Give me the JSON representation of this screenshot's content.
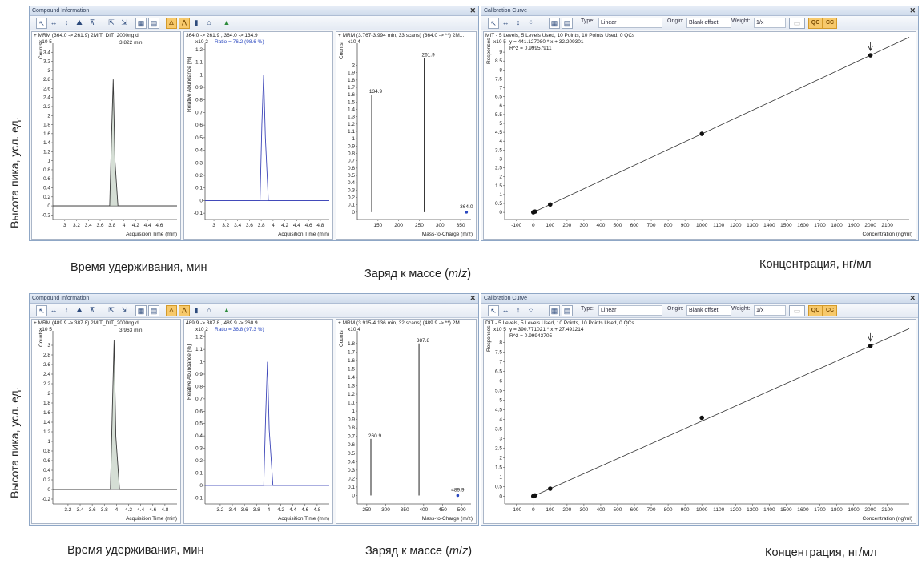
{
  "y_axis_caption": "Высота пика, усл. ед.",
  "rows": [
    {
      "compound_window_title": "Compound Information",
      "calibration_window_title": "Calibration Curve",
      "chrom": {
        "header": "+ MRM (364.0 -> 261.9) 2MIT_DIT_2000ng.d",
        "scale": "x10 5",
        "yunit": "Counts",
        "peak_label": "3.822 min.",
        "xaxis_title": "Acquisition Time (min)"
      },
      "qual": {
        "header": "364.0 -> 261.9 , 364.0 -> 134.9",
        "scale": "x10 2",
        "ratio": "Ratio = 76.2 (98.6 %)",
        "yunit": "Relative Abundance [%]",
        "xaxis_title": "Acquisition Time (min)"
      },
      "ms": {
        "header": "+ MRM (3.767-3.994 min, 33 scans) (364.0 -> **) 2M...",
        "scale": "x10 4",
        "yunit": "Counts",
        "peak_labels": [
          "134.9",
          "261.9",
          "364.0"
        ],
        "xaxis_title": "Mass-to-Charge (m/z)"
      },
      "cal": {
        "header": "MIT - 5 Levels, 5 Levels Used, 10 Points, 10 Points Used, 0 QCs",
        "scale": "x10 5",
        "equation": "y = 441.127080 * x + 32.209301",
        "r2": "R^2 = 0.99957911",
        "yunit": "Responses",
        "xaxis_title": "Concentration (ng/ml)"
      },
      "captions": {
        "time": "Время удерживания, мин",
        "mass_prefix": "Заряд к массе (",
        "mass_m": "m",
        "mass_sep": "/",
        "mass_z": "z",
        "mass_suffix": ")",
        "conc": "Концентрация, нг/мл"
      }
    },
    {
      "compound_window_title": "Compound Information",
      "calibration_window_title": "Calibration Curve",
      "chrom": {
        "header": "+ MRM (489.9 -> 387.8) 2MIT_DIT_2000ng.d",
        "scale": "x10 5",
        "yunit": "Counts",
        "peak_label": "3.963 min.",
        "xaxis_title": "Acquisition Time (min)"
      },
      "qual": {
        "header": "489.9 -> 387.8 , 489.9 -> 260.9",
        "scale": "x10 2",
        "ratio": "Ratio = 36.8 (97.3 %)",
        "yunit": "Relative Abundance [%]",
        "xaxis_title": "Acquisition Time (min)"
      },
      "ms": {
        "header": "+ MRM (3.915-4.136 min, 32 scans) (489.9 -> **) 2M...",
        "scale": "x10 4",
        "yunit": "Counts",
        "peak_labels": [
          "260.9",
          "387.8",
          "489.9"
        ],
        "xaxis_title": "Mass-to-Charge (m/z)"
      },
      "cal": {
        "header": "DIT - 5 Levels, 5 Levels Used, 10 Points, 10 Points Used, 0 QCs",
        "scale": "x10 5",
        "equation": "y = 390.771021 * x + 27.491214",
        "r2": "R^2 = 0.99943705",
        "yunit": "Responses",
        "xaxis_title": "Concentration (ng/ml)"
      },
      "captions": {
        "time": "Время удерживания, мин",
        "mass_prefix": "Заряд к массе (",
        "mass_m": "m",
        "mass_sep": "/",
        "mass_z": "z",
        "mass_suffix": ")",
        "conc": "Концентрация, нг/мл"
      }
    }
  ],
  "toolbar": {
    "type_label": "Type:",
    "type_value": "Linear",
    "origin_label": "Origin:",
    "origin_value": "Blank offset",
    "weight_label": "Weight:",
    "weight_value": "1/x",
    "qc_label": "QC",
    "cc_label": "CC",
    "icons": [
      "cursor-icon",
      "pan-horizontal-icon",
      "pan-vertical-icon",
      "peak-icon",
      "baseline-icon",
      "zoom-icon",
      "overlay-icon",
      "table-icon",
      "export-icon",
      "integrate-icon",
      "qualifier-icon",
      "bar-chart-icon",
      "spectrum-icon",
      "arrow-up-icon"
    ]
  },
  "chart_data": [
    {
      "type": "line",
      "title": "+ MRM (364.0 -> 261.9) 2MIT_DIT_2000ng.d",
      "xlabel": "Acquisition Time (min)",
      "ylabel": "Counts",
      "ylim": [
        -0.3,
        3.6
      ],
      "xlim": [
        2.8,
        4.9
      ],
      "yticks": [
        "-0.2",
        "0",
        "0.2",
        "0.4",
        "0.6",
        "0.8",
        "1",
        "1.2",
        "1.4",
        "1.6",
        "1.8",
        "2",
        "2.2",
        "2.4",
        "2.6",
        "2.8",
        "3",
        "3.2",
        "3.4"
      ],
      "xticks": [
        "3",
        "3.2",
        "3.4",
        "3.6",
        "3.8",
        "4",
        "4.2",
        "4.4",
        "4.6"
      ],
      "series": [
        {
          "name": "364.0 -> 261.9",
          "x": [
            2.8,
            3.76,
            3.79,
            3.82,
            3.85,
            3.9,
            4.9
          ],
          "y": [
            0,
            0,
            1.5,
            2.8,
            1.0,
            0,
            0
          ]
        }
      ]
    },
    {
      "type": "line",
      "title": "364.0 -> 261.9 , 364.0 -> 134.9",
      "xlabel": "Acquisition Time (min)",
      "ylabel": "Relative Abundance [%]",
      "ylim": [
        -0.15,
        1.25
      ],
      "xlim": [
        2.85,
        4.95
      ],
      "yticks": [
        "-0.1",
        "0",
        "0.1",
        "0.2",
        "0.3",
        "0.4",
        "0.5",
        "0.6",
        "0.7",
        "0.8",
        "0.9",
        "1",
        "1.1",
        "1.2"
      ],
      "xticks": [
        "3",
        "3.2",
        "3.4",
        "3.6",
        "3.8",
        "4",
        "4.2",
        "4.4",
        "4.6",
        "4.8"
      ],
      "series": [
        {
          "name": "364.0 -> 134.9",
          "x": [
            2.85,
            3.78,
            3.81,
            3.84,
            3.87,
            3.92,
            4.95
          ],
          "y": [
            0,
            0,
            0.6,
            1.0,
            0.5,
            0,
            0
          ]
        }
      ]
    },
    {
      "type": "bar",
      "title": "+ MRM (3.767-3.994 min, 33 scans) (364.0 -> **) 2M...",
      "xlabel": "Mass-to-Charge (m/z)",
      "ylabel": "Counts",
      "ylim": [
        -0.1,
        2.3
      ],
      "xlim": [
        100,
        375
      ],
      "yticks": [
        "0",
        "0.1",
        "0.2",
        "0.3",
        "0.4",
        "0.5",
        "0.6",
        "0.7",
        "0.8",
        "0.9",
        "1",
        "1.1",
        "1.2",
        "1.3",
        "1.4",
        "1.5",
        "1.6",
        "1.7",
        "1.8",
        "1.9",
        "2"
      ],
      "xticks": [
        "150",
        "200",
        "250",
        "300",
        "350"
      ],
      "x": [
        134.9,
        261.9,
        364.0
      ],
      "values": [
        1.6,
        2.1,
        0.0
      ]
    },
    {
      "type": "scatter",
      "title": "MIT - 5 Levels, 5 Levels Used, 10 Points, 10 Points Used, 0 QCs",
      "xlabel": "Concentration (ng/ml)",
      "ylabel": "Responses",
      "ylim": [
        -0.4,
        9.5
      ],
      "xlim": [
        -170,
        2230
      ],
      "yticks": [
        "-0.5",
        "0",
        "0.5",
        "1",
        "1.5",
        "2",
        "2.5",
        "3",
        "3.5",
        "4",
        "4.5",
        "5",
        "5.5",
        "6",
        "6.5",
        "7",
        "7.5",
        "8",
        "8.5",
        "9"
      ],
      "xticks": [
        "-100",
        "0",
        "100",
        "200",
        "300",
        "400",
        "500",
        "600",
        "700",
        "800",
        "900",
        "1000",
        "1100",
        "1200",
        "1300",
        "1400",
        "1500",
        "1600",
        "1700",
        "1800",
        "1900",
        "2000",
        "2100"
      ],
      "x": [
        0,
        10,
        100,
        1000,
        2000
      ],
      "y": [
        0.0032,
        0.0447,
        0.4414,
        4.4116,
        8.8228
      ],
      "fit": {
        "slope": 441.12708,
        "intercept": 32.209301
      }
    },
    {
      "type": "line",
      "title": "+ MRM (489.9 -> 387.8) 2MIT_DIT_2000ng.d",
      "xlabel": "Acquisition Time (min)",
      "ylabel": "Counts",
      "ylim": [
        -0.3,
        3.3
      ],
      "xlim": [
        2.95,
        5.0
      ],
      "yticks": [
        "-0.2",
        "0",
        "0.2",
        "0.4",
        "0.6",
        "0.8",
        "1",
        "1.2",
        "1.4",
        "1.6",
        "1.8",
        "2",
        "2.2",
        "2.4",
        "2.6",
        "2.8",
        "3"
      ],
      "xticks": [
        "3.2",
        "3.4",
        "3.6",
        "3.8",
        "4",
        "4.2",
        "4.4",
        "4.6",
        "4.8"
      ],
      "series": [
        {
          "name": "489.9 -> 387.8",
          "x": [
            2.95,
            3.9,
            3.93,
            3.96,
            3.99,
            4.05,
            5.0
          ],
          "y": [
            0,
            0,
            1.6,
            3.1,
            1.1,
            0,
            0
          ]
        }
      ]
    },
    {
      "type": "line",
      "title": "489.9 -> 387.8 , 489.9 -> 260.9",
      "xlabel": "Acquisition Time (min)",
      "ylabel": "Relative Abundance [%]",
      "ylim": [
        -0.15,
        1.25
      ],
      "xlim": [
        2.95,
        5.0
      ],
      "yticks": [
        "-0.1",
        "0",
        "0.1",
        "0.2",
        "0.3",
        "0.4",
        "0.5",
        "0.6",
        "0.7",
        "0.8",
        "0.9",
        "1",
        "1.1",
        "1.2"
      ],
      "xticks": [
        "3.2",
        "3.4",
        "3.6",
        "3.8",
        "4",
        "4.2",
        "4.4",
        "4.6",
        "4.8"
      ],
      "series": [
        {
          "name": "489.9 -> 260.9",
          "x": [
            2.95,
            3.92,
            3.95,
            3.98,
            4.01,
            4.07,
            5.0
          ],
          "y": [
            0,
            0,
            0.55,
            1.0,
            0.45,
            0,
            0
          ]
        }
      ]
    },
    {
      "type": "bar",
      "title": "+ MRM (3.915-4.136 min, 32 scans) (489.9 -> **) 2M...",
      "xlabel": "Mass-to-Charge (m/z)",
      "ylabel": "Counts",
      "ylim": [
        -0.1,
        1.95
      ],
      "xlim": [
        225,
        525
      ],
      "yticks": [
        "0",
        "0.1",
        "0.2",
        "0.3",
        "0.4",
        "0.5",
        "0.6",
        "0.7",
        "0.8",
        "0.9",
        "1",
        "1.1",
        "1.2",
        "1.3",
        "1.4",
        "1.5",
        "1.6",
        "1.7",
        "1.8"
      ],
      "xticks": [
        "250",
        "300",
        "350",
        "400",
        "450",
        "500"
      ],
      "x": [
        260.9,
        387.8,
        489.9
      ],
      "values": [
        0.67,
        1.8,
        0.0
      ]
    },
    {
      "type": "scatter",
      "title": "DIT - 5 Levels, 5 Levels Used, 10 Points, 10 Points Used, 0 QCs",
      "xlabel": "Concentration (ng/ml)",
      "ylabel": "Responses",
      "ylim": [
        -0.4,
        8.6
      ],
      "xlim": [
        -170,
        2230
      ],
      "yticks": [
        "-0.5",
        "0",
        "0.5",
        "1",
        "1.5",
        "2",
        "2.5",
        "3",
        "3.5",
        "4",
        "4.5",
        "5",
        "5.5",
        "6",
        "6.5",
        "7",
        "7.5",
        "8"
      ],
      "xticks": [
        "-100",
        "0",
        "100",
        "200",
        "300",
        "400",
        "500",
        "600",
        "700",
        "800",
        "900",
        "1000",
        "1100",
        "1200",
        "1300",
        "1400",
        "1500",
        "1600",
        "1700",
        "1800",
        "1900",
        "2000",
        "2100"
      ],
      "x": [
        0,
        10,
        100,
        1000,
        2000
      ],
      "y": [
        0.0027,
        0.0394,
        0.391,
        4.0781,
        7.8157
      ],
      "fit": {
        "slope": 390.771021,
        "intercept": 27.491214
      }
    }
  ]
}
